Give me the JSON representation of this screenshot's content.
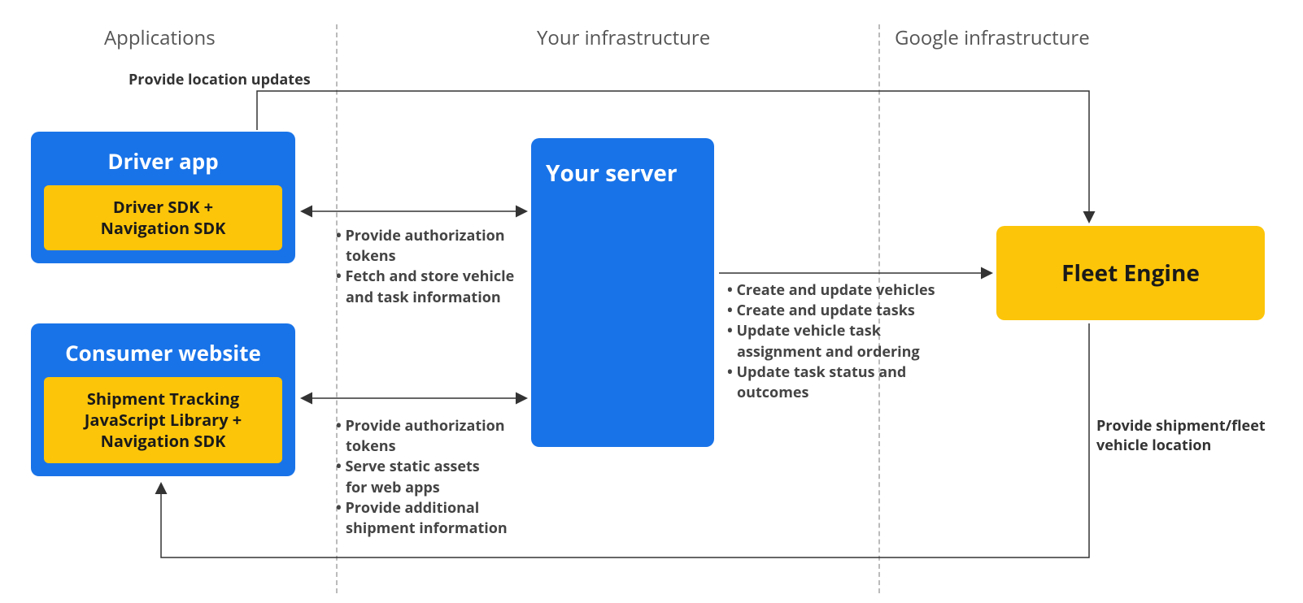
{
  "sections": {
    "apps": "Applications",
    "infra": "Your infrastructure",
    "google": "Google infrastructure"
  },
  "driver": {
    "title": "Driver app",
    "sdk": "Driver SDK +\nNavigation SDK"
  },
  "consumer": {
    "title": "Consumer website",
    "sdk": "Shipment Tracking\nJavaScript Library  +\nNavigation SDK"
  },
  "server": {
    "title": "Your server"
  },
  "fleet": {
    "title": "Fleet Engine"
  },
  "bullets_driver": {
    "b1": "Provide authorization",
    "b1s": "tokens",
    "b2": "Fetch and store vehicle",
    "b2s": "and task information"
  },
  "bullets_consumer": {
    "b1": "Provide authorization",
    "b1s": "tokens",
    "b2": "Serve static assets",
    "b2s": "for web apps",
    "b3": "Provide additional",
    "b3s": "shipment information"
  },
  "bullets_server": {
    "b1": "Create and update vehicles",
    "b2": "Create and update tasks",
    "b3": "Update vehicle task",
    "b3s": "assignment and ordering",
    "b4": "Update task status and",
    "b4s": "outcomes"
  },
  "edges": {
    "loc_updates": "Provide location updates",
    "fleet_loc1": "Provide shipment/fleet",
    "fleet_loc2": "vehicle location"
  }
}
